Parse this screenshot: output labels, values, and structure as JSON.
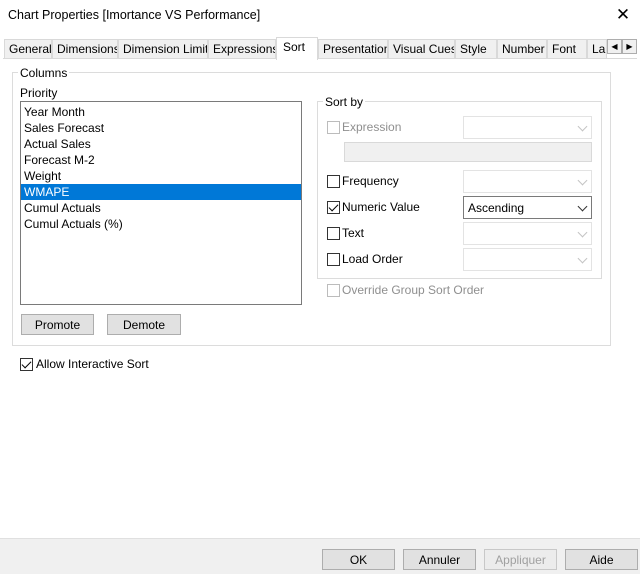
{
  "window": {
    "title": "Chart Properties [Imortance VS Performance]",
    "close_glyph": "✕"
  },
  "tabs": [
    {
      "label": "General",
      "active": false
    },
    {
      "label": "Dimensions",
      "active": false
    },
    {
      "label": "Dimension Limits",
      "active": false
    },
    {
      "label": "Expressions",
      "active": false
    },
    {
      "label": "Sort",
      "active": true
    },
    {
      "label": "Presentation",
      "active": false
    },
    {
      "label": "Visual Cues",
      "active": false
    },
    {
      "label": "Style",
      "active": false
    },
    {
      "label": "Number",
      "active": false
    },
    {
      "label": "Font",
      "active": false
    },
    {
      "label": "La",
      "active": false
    }
  ],
  "tab_scroll": {
    "left_glyph": "◀",
    "right_glyph": "▶"
  },
  "columns": {
    "group_label": "Columns",
    "priority_label": "Priority",
    "items": [
      "Year Month",
      "Sales Forecast",
      "Actual Sales",
      "Forecast M-2",
      "Weight",
      "WMAPE",
      "Cumul Actuals",
      "Cumul Actuals (%)"
    ],
    "selected_index": 5,
    "promote_label": "Promote",
    "demote_label": "Demote"
  },
  "sort_by": {
    "group_label": "Sort by",
    "expression": {
      "label": "Expression",
      "checked": false,
      "enabled": false,
      "value": ""
    },
    "frequency": {
      "label": "Frequency",
      "checked": false,
      "value": ""
    },
    "numeric_value": {
      "label": "Numeric Value",
      "checked": true,
      "value": "Ascending"
    },
    "text": {
      "label": "Text",
      "checked": false,
      "value": ""
    },
    "load_order": {
      "label": "Load Order",
      "checked": false,
      "value": ""
    },
    "override_group": {
      "label": "Override Group Sort Order",
      "checked": false,
      "enabled": false
    }
  },
  "allow_interactive_sort": {
    "label": "Allow Interactive Sort",
    "checked": true
  },
  "footer": {
    "ok": "OK",
    "cancel": "Annuler",
    "apply": "Appliquer",
    "help": "Aide"
  }
}
